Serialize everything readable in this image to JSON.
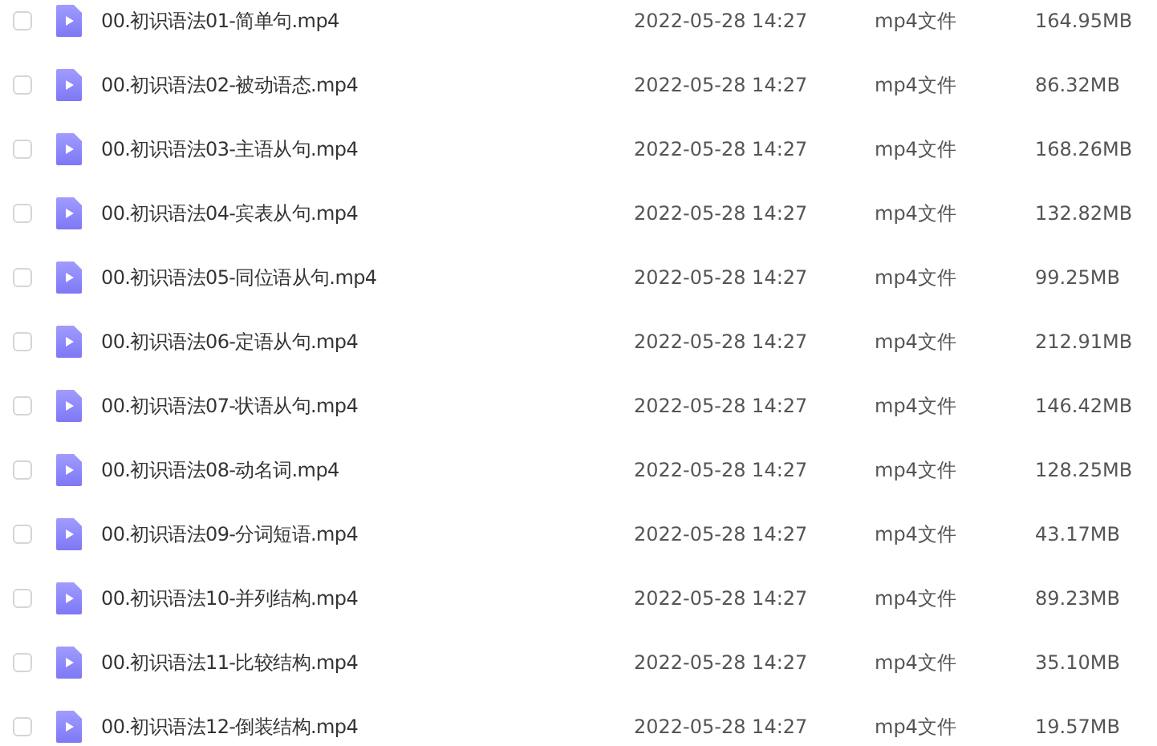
{
  "files": [
    {
      "name": "00.初识语法01-简单句.mp4",
      "date": "2022-05-28 14:27",
      "type": "mp4文件",
      "size": "164.95MB",
      "checked": false
    },
    {
      "name": "00.初识语法02-被动语态.mp4",
      "date": "2022-05-28 14:27",
      "type": "mp4文件",
      "size": "86.32MB",
      "checked": false
    },
    {
      "name": "00.初识语法03-主语从句.mp4",
      "date": "2022-05-28 14:27",
      "type": "mp4文件",
      "size": "168.26MB",
      "checked": false
    },
    {
      "name": "00.初识语法04-宾表从句.mp4",
      "date": "2022-05-28 14:27",
      "type": "mp4文件",
      "size": "132.82MB",
      "checked": false
    },
    {
      "name": "00.初识语法05-同位语从句.mp4",
      "date": "2022-05-28 14:27",
      "type": "mp4文件",
      "size": "99.25MB",
      "checked": false
    },
    {
      "name": "00.初识语法06-定语从句.mp4",
      "date": "2022-05-28 14:27",
      "type": "mp4文件",
      "size": "212.91MB",
      "checked": false
    },
    {
      "name": "00.初识语法07-状语从句.mp4",
      "date": "2022-05-28 14:27",
      "type": "mp4文件",
      "size": "146.42MB",
      "checked": false
    },
    {
      "name": "00.初识语法08-动名词.mp4",
      "date": "2022-05-28 14:27",
      "type": "mp4文件",
      "size": "128.25MB",
      "checked": false
    },
    {
      "name": "00.初识语法09-分词短语.mp4",
      "date": "2022-05-28 14:27",
      "type": "mp4文件",
      "size": "43.17MB",
      "checked": false
    },
    {
      "name": "00.初识语法10-并列结构.mp4",
      "date": "2022-05-28 14:27",
      "type": "mp4文件",
      "size": "89.23MB",
      "checked": false
    },
    {
      "name": "00.初识语法11-比较结构.mp4",
      "date": "2022-05-28 14:27",
      "type": "mp4文件",
      "size": "35.10MB",
      "checked": false
    },
    {
      "name": "00.初识语法12-倒装结构.mp4",
      "date": "2022-05-28 14:27",
      "type": "mp4文件",
      "size": "19.57MB",
      "checked": false
    }
  ]
}
